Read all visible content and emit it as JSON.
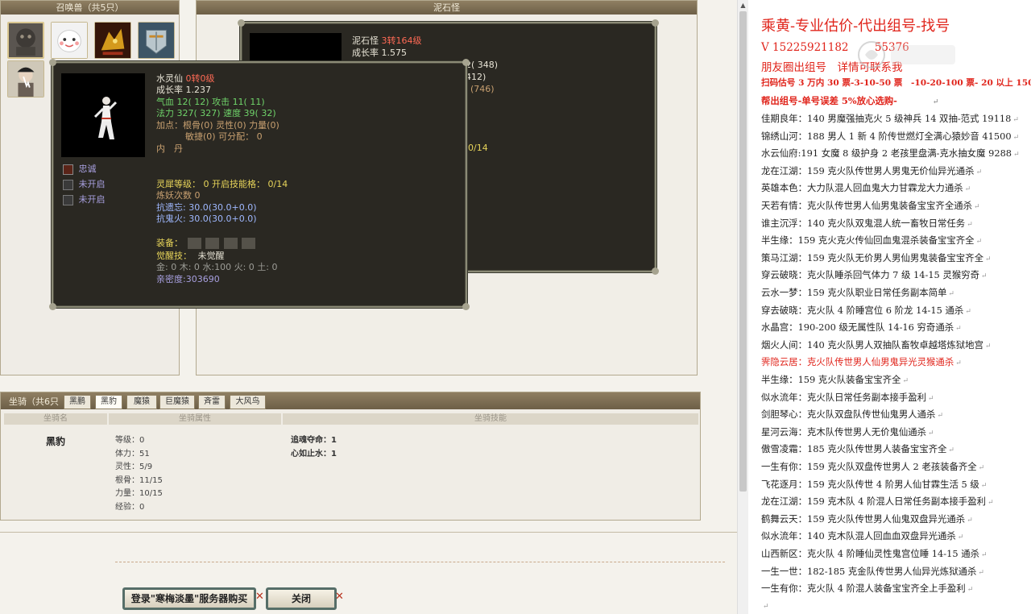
{
  "pet_panel": {
    "title": "召唤兽（共5只）"
  },
  "detail_panel": {
    "title": "泥石怪"
  },
  "tip_back": {
    "name": "泥石怪",
    "level": "3转164级",
    "growth": "成长率 1.575",
    "frag1": "2( 348)",
    "frag2": "412)",
    "frag3": "(746)",
    "frag4": "0/14"
  },
  "tip_front": {
    "name": "水灵仙",
    "level": "0转0级",
    "growth": "成长率 1.237",
    "hp_line": "气血 12( 12) 攻击 11( 11)",
    "mp_line": "法力 327( 327) 速度 39( 32)",
    "points_line": "加点：根骨(0) 灵性(0) 力量(0)",
    "points_line2": "敏捷(0) 可分配： 0",
    "neidan": "内　丹",
    "skills": [
      {
        "label": "忠诚"
      },
      {
        "label": "未开启"
      },
      {
        "label": "未开启"
      }
    ],
    "ling_xi": "灵犀等级： 0 开启技能格： 0/14",
    "lianyao": "炼妖次数 0",
    "resist1": "抗遗忘: 30.0(30.0+0.0)",
    "resist2": "抗鬼火: 30.0(30.0+0.0)",
    "equip_label": "装备：",
    "awaken_label": "觉醒技：",
    "awaken_value": "未觉醒",
    "elements": "金: 0 木: 0 水:100 火: 0 土: 0",
    "intimacy": "亲密度:303690"
  },
  "mount": {
    "title": "坐骑（共6只",
    "tabs": [
      "黑鹏",
      "黑豹",
      "魔猿",
      "巨魔猿",
      "斉雷",
      "大风鸟"
    ],
    "selected_tab": 1,
    "col_name": "坐骑名",
    "col_attr": "坐骑属性",
    "col_skill": "坐骑技能",
    "name": "黑豹",
    "stats": [
      "等级：0",
      "体力：51",
      "灵性：5/9",
      "根骨：11/15",
      "力量：10/15",
      "经验：0"
    ],
    "skills": [
      "追魂夺命：1",
      "心如止水：1"
    ]
  },
  "buttons": {
    "buy": "登录\"寒梅淡墨\"服务器购买",
    "close": "关闭"
  },
  "doc": {
    "title": "乘黄-专业估价-代出组号-找号",
    "phone": "V 15225921182",
    "phone_tail": "55376",
    "line3": "朋友圈出组号　详情可联系我",
    "line4": "扫码估号 3 万内 30 票-3-10-50 票　-10-20-100 票- 20 以上 150",
    "line5": "帮出组号-单号误差 5%放心选购-",
    "entries": [
      "佳期良年：140 男魔强抽克火 5 级神兵 14 双抽-范式 19118",
      "锦绣山河：188 男人 1 新 4 阶传世燃灯全满心猿妙音 41500",
      "水云仙府:191 女魔 8 级护身 2 老孩里盘满-克水抽女魔 9288",
      "龙在江湖：159 克火队传世男人男鬼无价仙异光通杀",
      "英雄本色：大力队混人回血鬼大力甘霖龙大力通杀",
      "天若有情：克火队传世男人仙男鬼装备宝宝齐全通杀",
      "谁主沉浮：140 克火队双鬼混人统一畜牧日常任务",
      "半生缘：159 克火克火传仙回血鬼混杀装备宝宝齐全",
      "策马江湖：159 克火队无价男人男仙男鬼装备宝宝齐全",
      "穿云破晓：克火队睡杀回气体力 7 级 14-15 灵猴穷奇",
      "云水一梦：159 克火队职业日常任务副本简单",
      "穿去破晓：克火队 4 阶睡宫位 6 阶龙 14-15 通杀",
      "水晶宫：190-200 级无属性队 14-16 穷奇通杀",
      "烟火人间：140 克火队男人双抽队畜牧卓越塔炼狱地宫",
      "霁隐云居：克火队传世男人仙男鬼异光灵猴通杀",
      "半生缘：159 克火队装备宝宝齐全",
      "似水流年：克火队日常任务副本接手盈利",
      "剑胆琴心：克火队双盘队传世仙鬼男人通杀",
      "星河云海：克木队传世男人无价鬼仙通杀",
      "傲雪凌霜：185 克火队传世男人装备宝宝齐全",
      "一生有你：159 克火队双盘传世男人 2 老孩装备齐全",
      "飞花逐月：159 克火队传世 4 阶男人仙甘霖生活 5 级",
      "龙在江湖：159 克木队 4 阶混人日常任务副本接手盈利",
      "鹤舞云天：159 克火队传世男人仙鬼双盘异光通杀",
      "似水流年：140 克木队混人回血血双盘异光通杀",
      "山西新区：克火队 4 阶睡仙灵性鬼宫位睡 14-15 通杀",
      "一生一世：182-185 克金队传世男人仙异光炼狱通杀",
      "一生有你：克火队 4 阶混人装备宝宝齐全上手盈利"
    ],
    "highlight_index": 14,
    "paragraph_mark": "↵",
    "colors": {
      "red": "#e0241b",
      "black": "#222222"
    }
  }
}
